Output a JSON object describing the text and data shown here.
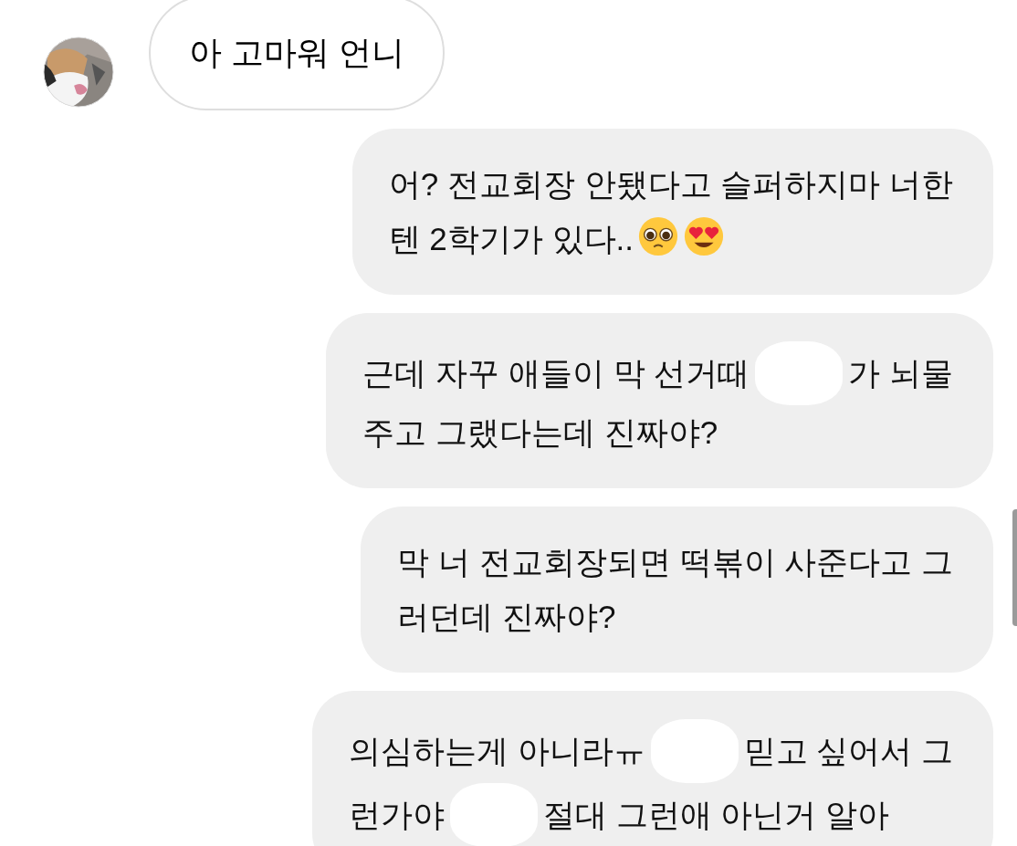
{
  "messages": [
    {
      "kind": "incoming",
      "lines": [
        [
          {
            "kind": "text",
            "text": "아 고마워 언니"
          }
        ]
      ]
    },
    {
      "kind": "outgoing",
      "lines": [
        [
          {
            "kind": "text",
            "text": "어? 전교회장 안됐다고 슬퍼하지마 너한"
          }
        ],
        [
          {
            "kind": "text",
            "text": "텐 2학기가 있다.."
          },
          {
            "kind": "pleading"
          },
          {
            "kind": "adoring"
          }
        ]
      ]
    },
    {
      "kind": "outgoing",
      "lines": [
        [
          {
            "kind": "text",
            "text": "근데 자꾸 애들이 막 선거때"
          },
          {
            "kind": "redacted"
          },
          {
            "kind": "text",
            "text": "가 뇌물"
          }
        ],
        [
          {
            "kind": "text",
            "text": "주고 그랬다는데 진짜야?"
          }
        ]
      ]
    },
    {
      "kind": "outgoing",
      "lines": [
        [
          {
            "kind": "text",
            "text": "막 너 전교회장되면 떡볶이 사준다고 그"
          }
        ],
        [
          {
            "kind": "text",
            "text": "러던데 진짜야?"
          }
        ]
      ]
    },
    {
      "kind": "outgoing",
      "lines": [
        [
          {
            "kind": "text",
            "text": "의심하는게 아니라ㅠ"
          },
          {
            "kind": "redacted"
          },
          {
            "kind": "text",
            "text": "믿고 싶어서 그"
          }
        ],
        [
          {
            "kind": "text",
            "text": "런가야"
          },
          {
            "kind": "redacted"
          },
          {
            "kind": "text",
            "text": "절대 그런애 아닌거 알아"
          }
        ]
      ]
    }
  ]
}
